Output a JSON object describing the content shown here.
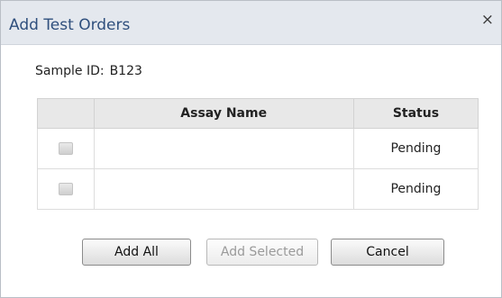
{
  "dialog": {
    "title": "Add Test Orders",
    "close_glyph": "×"
  },
  "sample": {
    "label": "Sample ID:",
    "value": "B123"
  },
  "table": {
    "columns": [
      "",
      "Assay Name",
      "Status"
    ],
    "rows": [
      {
        "assay": "",
        "status": "Pending"
      },
      {
        "assay": "",
        "status": "Pending"
      }
    ]
  },
  "buttons": {
    "add_all": "Add All",
    "add_selected": "Add Selected",
    "cancel": "Cancel"
  }
}
